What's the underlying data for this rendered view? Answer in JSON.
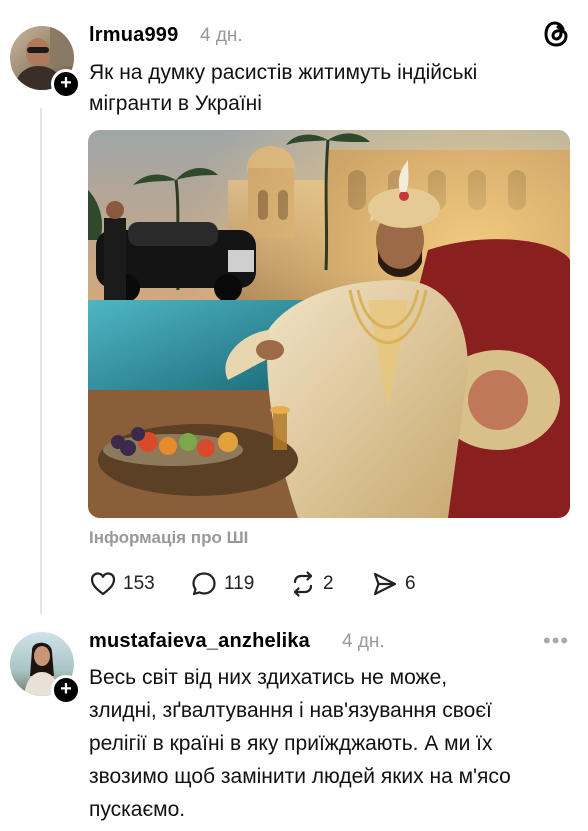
{
  "post": {
    "username": "lrmua999",
    "time": "4 дн.",
    "text_line1": "Як на думку расистів житимуть індійські",
    "text_line2": "мігранти в Україні",
    "ai_label": "Інформація про ШІ",
    "likes": "153",
    "comments": "119",
    "reposts": "2",
    "shares": "6"
  },
  "reply": {
    "username": "mustafaieva_anzhelika",
    "time": "4 дн.",
    "lines": [
      "Весь світ від них здихатись не може,",
      "злидні, зґвалтування і нав'язування своєї",
      "релігії в країні в яку приїжджають. А ми їх",
      "звозимо щоб замінити людей яких на м'ясо",
      "пускаємо."
    ],
    "more": "•••"
  },
  "icons": {
    "logo": "threads-logo-icon",
    "like": "heart-icon",
    "comment": "comment-icon",
    "repost": "repost-icon",
    "share": "send-icon",
    "add": "plus-icon"
  },
  "colors": {
    "muted": "#999999",
    "thread_line": "#e4e4e4",
    "text": "#111111"
  }
}
